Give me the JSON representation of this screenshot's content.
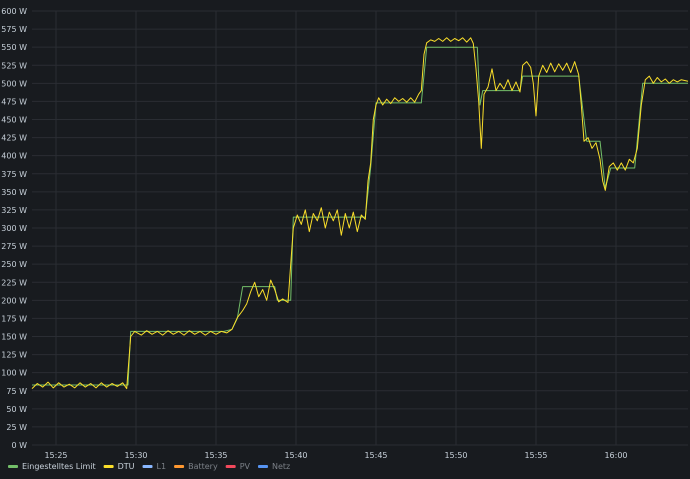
{
  "chart_data": {
    "type": "line",
    "title": "",
    "xlabel": "",
    "ylabel": "",
    "ylim": [
      0,
      600
    ],
    "y_ticks": [
      0,
      25,
      50,
      75,
      100,
      125,
      150,
      175,
      200,
      225,
      250,
      275,
      300,
      325,
      350,
      375,
      400,
      425,
      450,
      475,
      500,
      525,
      550,
      575,
      600
    ],
    "y_unit": " W",
    "xlim": [
      "15:23:30",
      "16:04:30"
    ],
    "x_ticks": [
      "15:25",
      "15:30",
      "15:35",
      "15:40",
      "15:45",
      "15:50",
      "15:55",
      "16:00"
    ],
    "grid": true,
    "legend_position": "bottom-left",
    "series": [
      {
        "name": "Eingestelltes Limit",
        "color": "#73bf69",
        "visible": true,
        "points": [
          [
            "15:23:30",
            83
          ],
          [
            "15:29:30",
            83
          ],
          [
            "15:29:40",
            157
          ],
          [
            "15:35:30",
            157
          ],
          [
            "15:36:00",
            160
          ],
          [
            "15:36:20",
            175
          ],
          [
            "15:36:40",
            219
          ],
          [
            "15:38:40",
            219
          ],
          [
            "15:38:50",
            200
          ],
          [
            "15:39:40",
            200
          ],
          [
            "15:39:50",
            315
          ],
          [
            "15:44:20",
            315
          ],
          [
            "15:44:40",
            384
          ],
          [
            "15:45:00",
            473
          ],
          [
            "15:47:50",
            473
          ],
          [
            "15:48:10",
            550
          ],
          [
            "15:51:20",
            550
          ],
          [
            "15:51:30",
            470
          ],
          [
            "15:51:40",
            490
          ],
          [
            "15:54:00",
            490
          ],
          [
            "15:54:10",
            510
          ],
          [
            "15:57:40",
            510
          ],
          [
            "15:58:10",
            420
          ],
          [
            "15:59:00",
            420
          ],
          [
            "15:59:20",
            355
          ],
          [
            "15:59:40",
            383
          ],
          [
            "16:01:10",
            383
          ],
          [
            "16:01:40",
            500
          ],
          [
            "16:04:30",
            500
          ]
        ]
      },
      {
        "name": "DTU",
        "color": "#fade2a",
        "visible": true,
        "points": [
          [
            "15:23:30",
            78
          ],
          [
            "15:23:50",
            85
          ],
          [
            "15:24:10",
            80
          ],
          [
            "15:24:30",
            87
          ],
          [
            "15:24:50",
            79
          ],
          [
            "15:25:10",
            86
          ],
          [
            "15:25:30",
            80
          ],
          [
            "15:25:50",
            84
          ],
          [
            "15:26:10",
            79
          ],
          [
            "15:26:30",
            86
          ],
          [
            "15:26:50",
            80
          ],
          [
            "15:27:10",
            85
          ],
          [
            "15:27:30",
            79
          ],
          [
            "15:27:50",
            86
          ],
          [
            "15:28:10",
            80
          ],
          [
            "15:28:30",
            85
          ],
          [
            "15:28:50",
            81
          ],
          [
            "15:29:10",
            86
          ],
          [
            "15:29:25",
            78
          ],
          [
            "15:29:40",
            150
          ],
          [
            "15:29:55",
            157
          ],
          [
            "15:30:20",
            152
          ],
          [
            "15:30:40",
            158
          ],
          [
            "15:31:00",
            153
          ],
          [
            "15:31:20",
            157
          ],
          [
            "15:31:40",
            152
          ],
          [
            "15:32:00",
            158
          ],
          [
            "15:32:20",
            153
          ],
          [
            "15:32:40",
            157
          ],
          [
            "15:33:00",
            152
          ],
          [
            "15:33:20",
            158
          ],
          [
            "15:33:40",
            153
          ],
          [
            "15:34:00",
            157
          ],
          [
            "15:34:20",
            152
          ],
          [
            "15:34:40",
            157
          ],
          [
            "15:35:00",
            153
          ],
          [
            "15:35:20",
            157
          ],
          [
            "15:35:40",
            155
          ],
          [
            "15:36:00",
            160
          ],
          [
            "15:36:20",
            176
          ],
          [
            "15:36:40",
            186
          ],
          [
            "15:36:55",
            195
          ],
          [
            "15:37:10",
            212
          ],
          [
            "15:37:25",
            225
          ],
          [
            "15:37:40",
            205
          ],
          [
            "15:37:55",
            215
          ],
          [
            "15:38:10",
            200
          ],
          [
            "15:38:25",
            228
          ],
          [
            "15:38:40",
            215
          ],
          [
            "15:38:55",
            198
          ],
          [
            "15:39:10",
            202
          ],
          [
            "15:39:30",
            197
          ],
          [
            "15:39:50",
            300
          ],
          [
            "15:40:05",
            318
          ],
          [
            "15:40:20",
            305
          ],
          [
            "15:40:35",
            325
          ],
          [
            "15:40:50",
            295
          ],
          [
            "15:41:05",
            320
          ],
          [
            "15:41:20",
            310
          ],
          [
            "15:41:35",
            328
          ],
          [
            "15:41:50",
            300
          ],
          [
            "15:42:05",
            322
          ],
          [
            "15:42:20",
            310
          ],
          [
            "15:42:35",
            325
          ],
          [
            "15:42:50",
            290
          ],
          [
            "15:43:05",
            320
          ],
          [
            "15:43:20",
            300
          ],
          [
            "15:43:35",
            322
          ],
          [
            "15:43:50",
            295
          ],
          [
            "15:44:05",
            318
          ],
          [
            "15:44:20",
            312
          ],
          [
            "15:44:30",
            365
          ],
          [
            "15:44:40",
            390
          ],
          [
            "15:44:50",
            450
          ],
          [
            "15:45:00",
            470
          ],
          [
            "15:45:10",
            480
          ],
          [
            "15:45:25",
            470
          ],
          [
            "15:45:40",
            478
          ],
          [
            "15:45:55",
            472
          ],
          [
            "15:46:10",
            480
          ],
          [
            "15:46:25",
            475
          ],
          [
            "15:46:40",
            479
          ],
          [
            "15:46:55",
            474
          ],
          [
            "15:47:10",
            480
          ],
          [
            "15:47:25",
            474
          ],
          [
            "15:47:40",
            485
          ],
          [
            "15:47:50",
            490
          ],
          [
            "15:48:00",
            540
          ],
          [
            "15:48:10",
            556
          ],
          [
            "15:48:25",
            560
          ],
          [
            "15:48:40",
            558
          ],
          [
            "15:48:55",
            562
          ],
          [
            "15:49:10",
            558
          ],
          [
            "15:49:25",
            563
          ],
          [
            "15:49:40",
            558
          ],
          [
            "15:49:55",
            562
          ],
          [
            "15:50:10",
            559
          ],
          [
            "15:50:25",
            563
          ],
          [
            "15:50:40",
            557
          ],
          [
            "15:50:55",
            563
          ],
          [
            "15:51:05",
            555
          ],
          [
            "15:51:15",
            520
          ],
          [
            "15:51:25",
            475
          ],
          [
            "15:51:35",
            410
          ],
          [
            "15:51:45",
            485
          ],
          [
            "15:52:00",
            495
          ],
          [
            "15:52:15",
            520
          ],
          [
            "15:52:30",
            490
          ],
          [
            "15:52:45",
            500
          ],
          [
            "15:53:00",
            492
          ],
          [
            "15:53:15",
            505
          ],
          [
            "15:53:30",
            490
          ],
          [
            "15:53:45",
            502
          ],
          [
            "15:54:00",
            488
          ],
          [
            "15:54:10",
            525
          ],
          [
            "15:54:25",
            530
          ],
          [
            "15:54:40",
            522
          ],
          [
            "15:54:50",
            500
          ],
          [
            "15:55:00",
            455
          ],
          [
            "15:55:10",
            510
          ],
          [
            "15:55:25",
            525
          ],
          [
            "15:55:40",
            515
          ],
          [
            "15:55:55",
            528
          ],
          [
            "15:56:10",
            516
          ],
          [
            "15:56:25",
            527
          ],
          [
            "15:56:40",
            518
          ],
          [
            "15:56:55",
            528
          ],
          [
            "15:57:10",
            515
          ],
          [
            "15:57:25",
            530
          ],
          [
            "15:57:40",
            512
          ],
          [
            "15:57:50",
            470
          ],
          [
            "15:58:00",
            420
          ],
          [
            "15:58:15",
            425
          ],
          [
            "15:58:30",
            410
          ],
          [
            "15:58:45",
            418
          ],
          [
            "15:59:00",
            395
          ],
          [
            "15:59:10",
            365
          ],
          [
            "15:59:20",
            352
          ],
          [
            "15:59:35",
            385
          ],
          [
            "15:59:50",
            390
          ],
          [
            "16:00:05",
            380
          ],
          [
            "16:00:20",
            390
          ],
          [
            "16:00:35",
            380
          ],
          [
            "16:00:50",
            395
          ],
          [
            "16:01:05",
            390
          ],
          [
            "16:01:20",
            410
          ],
          [
            "16:01:35",
            470
          ],
          [
            "16:01:50",
            505
          ],
          [
            "16:02:05",
            510
          ],
          [
            "16:02:20",
            500
          ],
          [
            "16:02:35",
            508
          ],
          [
            "16:02:50",
            502
          ],
          [
            "16:03:05",
            506
          ],
          [
            "16:03:20",
            500
          ],
          [
            "16:03:35",
            505
          ],
          [
            "16:03:50",
            502
          ],
          [
            "16:04:05",
            505
          ],
          [
            "16:04:30",
            503
          ]
        ]
      },
      {
        "name": "L1",
        "color": "#8ab8ff",
        "visible": false,
        "points": []
      },
      {
        "name": "Battery",
        "color": "#ff9830",
        "visible": false,
        "points": []
      },
      {
        "name": "PV",
        "color": "#f2495c",
        "visible": false,
        "points": []
      },
      {
        "name": "Netz",
        "color": "#5794f2",
        "visible": false,
        "points": []
      }
    ]
  }
}
